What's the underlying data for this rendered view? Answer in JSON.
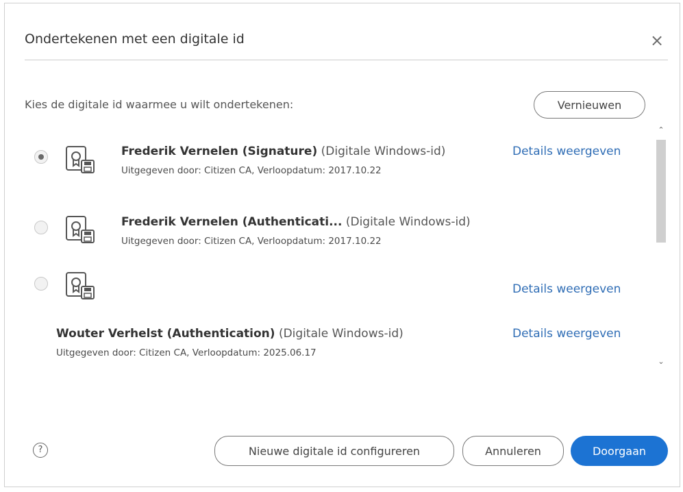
{
  "dialog": {
    "title": "Ondertekenen met een digitale id",
    "close_label": "×",
    "instruction": "Kies de digitale id waarmee u wilt ondertekenen:",
    "refresh_label": "Vernieuwen"
  },
  "ids": [
    {
      "name": "Frederik Vernelen (Signature)",
      "type": "(Digitale Windows-id)",
      "issuer": "Uitgegeven door: Citizen CA, Verloopdatum: 2017.10.22",
      "details_label": "Details weergeven",
      "selected": true
    },
    {
      "name": "Frederik Vernelen (Authenticati...",
      "type": "(Digitale Windows-id)",
      "issuer": "Uitgegeven door: Citizen CA, Verloopdatum: 2017.10.22",
      "details_label": "",
      "selected": false
    },
    {
      "name": "",
      "type": "",
      "issuer": "",
      "details_label": "Details weergeven",
      "selected": false
    },
    {
      "name": "Wouter Verhelst (Authentication)",
      "type": "(Digitale Windows-id)",
      "issuer": "Uitgegeven door: Citizen CA, Verloopdatum: 2025.06.17",
      "details_label": "Details weergeven",
      "selected": false
    }
  ],
  "footer": {
    "help_label": "?",
    "configure_label": "Nieuwe digitale id configureren",
    "cancel_label": "Annuleren",
    "continue_label": "Doorgaan"
  },
  "colors": {
    "accent": "#1c73d3",
    "link": "#2f6db5"
  },
  "icons": {
    "close": "close-icon",
    "certificate": "certificate-icon",
    "help": "help-icon",
    "scroll_up": "chevron-up-icon",
    "scroll_down": "chevron-down-icon"
  }
}
